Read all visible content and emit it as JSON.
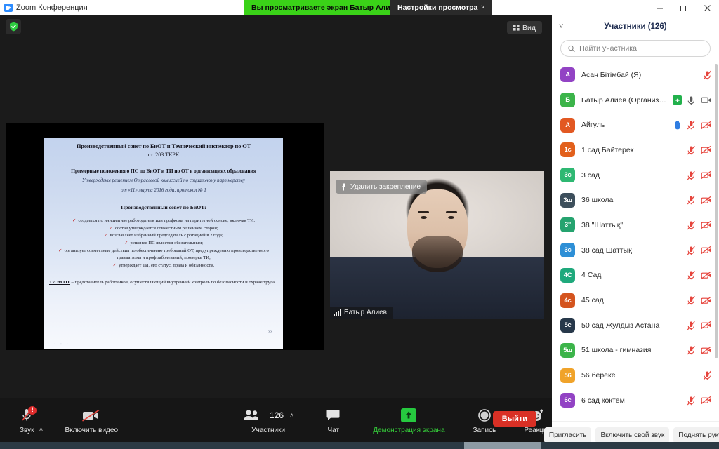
{
  "titlebar": {
    "app_title": "Zoom Конференция",
    "share_banner": "Вы просматриваете экран Батыр Алиев",
    "view_settings": "Настройки просмотра",
    "chevron": "˅",
    "minimize_name": "minimize-icon",
    "maximize_name": "maximize-icon",
    "close_name": "close-icon"
  },
  "stage": {
    "view_button": "Вид",
    "shield_icon": "security-shield-icon"
  },
  "slide": {
    "heading1": "Производственный совет по БиОТ и Технический инспектор по ОТ",
    "heading1_sub": "ст. 203 ТКРК",
    "heading2": "Примерные положения о ПС по БиОТ и ТИ по ОТ в организациях образования",
    "italic1": "Утверждены решением Отраслевой комиссией по социальному партнерству",
    "italic2": "от «11» марта 2016 года, протокол № 1",
    "heading3": "Производственный совет по БиОТ:",
    "bullets": [
      "создается по инициативе работодателя или профкома на паритетной основе, включая ТИ;",
      "состав утверждается совместным решением сторон;",
      "возглавляет избранный председатель с ротацией в 2 года;",
      "решение ПС является обязательным;",
      "организует совместные действия по обеспечению требований ОТ, предупреждению производственного травматизма и проф.заболеваний, проверке ТИ;",
      "утверждает ТИ, его статус, права и обязанности."
    ],
    "footer_bold": "ТИ по ОТ",
    "footer_text": " – представитель работников, осуществляющий внутренний контроль по безопасности и охране труда",
    "page_number": "22",
    "check_mark": "✓"
  },
  "video": {
    "unpin_label": "Удалить закрепление",
    "pin_icon": "pin-icon",
    "speaker_name": "Батыр Алиев",
    "signal_icon": "signal-strength-icon"
  },
  "toolbar": {
    "audio_label": "Звук",
    "video_label": "Включить видео",
    "participants_label": "Участники",
    "participants_count": "126",
    "chat_label": "Чат",
    "share_label": "Демонстрация экрана",
    "record_label": "Запись",
    "reactions_label": "Реакции",
    "leave_label": "Выйти",
    "caret": "˄",
    "warn_badge": "!",
    "colors": {
      "share_green": "#35d03a",
      "leave_red": "#d93025",
      "warn_red": "#e02d2d"
    }
  },
  "panel": {
    "title": "Участники (126)",
    "collapse_chevron": "˅",
    "search_placeholder": "Найти участника",
    "search_value": "",
    "search_icon": "search-icon",
    "buttons": {
      "invite": "Пригласить",
      "unmute": "Включить свой звук",
      "raise_hand": "Поднять руку"
    },
    "participants": [
      {
        "initials": "А",
        "name": "Асан Бітімбай (Я)",
        "color": "#9243c4",
        "mic": "muted",
        "video": "none",
        "host": false,
        "hand": false
      },
      {
        "initials": "Б",
        "name": "Батыр Алиев (Организатор)",
        "color": "#3cb44a",
        "mic": "on",
        "video": "on",
        "host": true,
        "hand": false
      },
      {
        "initials": "А",
        "name": "Айгуль",
        "color": "#e25822",
        "mic": "muted",
        "video": "muted",
        "host": false,
        "hand": true
      },
      {
        "initials": "1с",
        "name": "1 сад Байтерек",
        "color": "#e2601c",
        "mic": "muted",
        "video": "muted",
        "host": false,
        "hand": false
      },
      {
        "initials": "3с",
        "name": "3 сад",
        "color": "#2eb872",
        "mic": "muted",
        "video": "muted",
        "host": false,
        "hand": false
      },
      {
        "initials": "3ш",
        "name": "36 школа",
        "color": "#3d4f5c",
        "mic": "muted",
        "video": "muted",
        "host": false,
        "hand": false
      },
      {
        "initials": "3\"",
        "name": "38 \"Шаттық\"",
        "color": "#25a36f",
        "mic": "muted",
        "video": "muted",
        "host": false,
        "hand": false
      },
      {
        "initials": "3с",
        "name": "38 сад Шаттық",
        "color": "#2d8fd6",
        "mic": "muted",
        "video": "muted",
        "host": false,
        "hand": false
      },
      {
        "initials": "4С",
        "name": "4 Сад",
        "color": "#1fa97c",
        "mic": "muted",
        "video": "muted",
        "host": false,
        "hand": false
      },
      {
        "initials": "4с",
        "name": "45 сад",
        "color": "#d4541e",
        "mic": "muted",
        "video": "muted",
        "host": false,
        "hand": false
      },
      {
        "initials": "5с",
        "name": "50 сад Жулдыз Астана",
        "color": "#27384a",
        "mic": "muted",
        "video": "muted",
        "host": false,
        "hand": false
      },
      {
        "initials": "5ш",
        "name": "51 школа - гимназия",
        "color": "#3cb44a",
        "mic": "muted",
        "video": "muted",
        "host": false,
        "hand": false
      },
      {
        "initials": "56",
        "name": "56 береке",
        "color": "#f0a32a",
        "mic": "muted",
        "video": "none",
        "host": false,
        "hand": false
      },
      {
        "initials": "6с",
        "name": "6 сад көктем",
        "color": "#9243c4",
        "mic": "muted",
        "video": "muted",
        "host": false,
        "hand": false
      }
    ]
  }
}
